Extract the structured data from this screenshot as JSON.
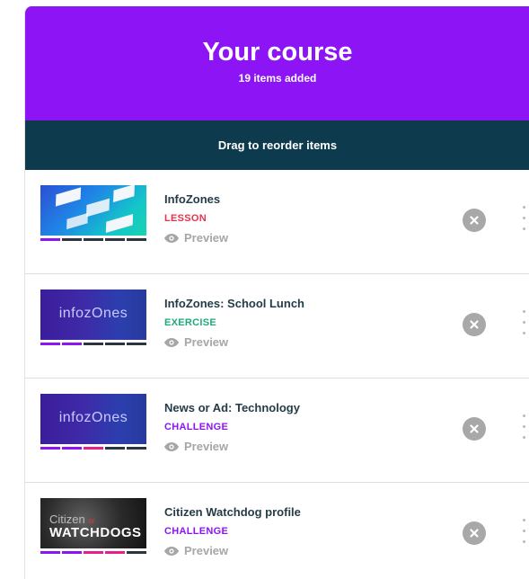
{
  "header": {
    "title": "Your course",
    "count": "19 items added"
  },
  "bar": {
    "label": "Drag to reorder items"
  },
  "items": [
    {
      "name": "InfoZones",
      "type": "LESSON",
      "type_color": "#e8334a",
      "preview": "Preview",
      "progress": [
        "#8c14f5",
        "#2a3540",
        "#2a3540",
        "#2a3540",
        "#2a3540"
      ]
    },
    {
      "name": "InfoZones: School Lunch",
      "type": "EXERCISE",
      "type_color": "#21a87a",
      "preview": "Preview",
      "thumb_text": "infozOnes",
      "progress": [
        "#8c14f5",
        "#8c14f5",
        "#2a3540",
        "#2a3540",
        "#2a3540"
      ]
    },
    {
      "name": "News or Ad: Technology",
      "type": "CHALLENGE",
      "type_color": "#8c14f5",
      "preview": "Preview",
      "thumb_text": "infozOnes",
      "progress": [
        "#8c14f5",
        "#8c14f5",
        "#e91e8c",
        "#2a3540",
        "#2a3540"
      ]
    },
    {
      "name": "Citizen Watchdog profile",
      "type": "CHALLENGE",
      "type_color": "#8c14f5",
      "preview": "Preview",
      "thumb_text_1": "Citizen",
      "thumb_text_1b": "or",
      "thumb_text_2": "WATCHDOGS",
      "progress": [
        "#8c14f5",
        "#8c14f5",
        "#e91e8c",
        "#e91e8c",
        "#2a3540"
      ]
    }
  ]
}
